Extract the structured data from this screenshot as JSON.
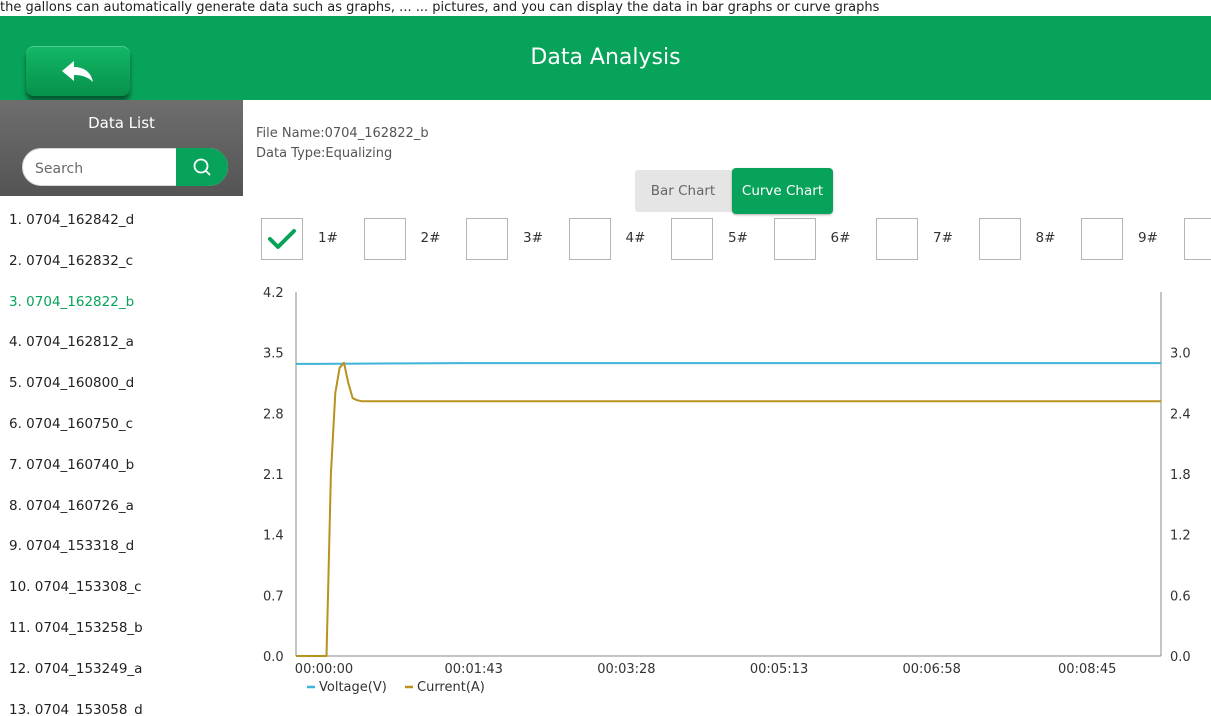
{
  "top_strip_text": "the gallons can automatically generate data such as graphs, ... ... pictures, and you can display the data in bar graphs or curve graphs",
  "header": {
    "title": "Data Analysis",
    "back_icon": "back-arrow-icon"
  },
  "sidebar": {
    "title": "Data List",
    "search": {
      "placeholder": "Search",
      "value": ""
    },
    "items": [
      "1. 0704_162842_d",
      "2. 0704_162832_c",
      "3. 0704_162822_b",
      "4. 0704_162812_a",
      "5. 0704_160800_d",
      "6. 0704_160750_c",
      "7. 0704_160740_b",
      "8. 0704_160726_a",
      "9. 0704_153318_d",
      "10. 0704_153308_c",
      "11. 0704_153258_b",
      "12. 0704_153249_a",
      "13. 0704_153058_d"
    ],
    "selected_index": 2
  },
  "file_info": {
    "file_name": "File Name:0704_162822_b",
    "data_type": "Data Type:Equalizing"
  },
  "view_toggle": {
    "bar_label": "Bar Chart",
    "curve_label": "Curve Chart",
    "active": "Curve Chart"
  },
  "channels": [
    {
      "label": "1#",
      "checked": true
    },
    {
      "label": "2#",
      "checked": false
    },
    {
      "label": "3#",
      "checked": false
    },
    {
      "label": "4#",
      "checked": false
    },
    {
      "label": "5#",
      "checked": false
    },
    {
      "label": "6#",
      "checked": false
    },
    {
      "label": "7#",
      "checked": false
    },
    {
      "label": "8#",
      "checked": false
    },
    {
      "label": "9#",
      "checked": false
    },
    {
      "label": "",
      "checked": false
    }
  ],
  "colors": {
    "primary_green": "#08a35a",
    "voltage": "#3fb4d9",
    "current": "#b8921e",
    "selected_item": "#08a35a"
  },
  "chart_data": {
    "type": "line",
    "x_unit": "seconds",
    "x_ticks": [
      "00:00:00",
      "00:01:43",
      "00:03:28",
      "00:05:13",
      "00:06:58",
      "00:08:45"
    ],
    "x_tick_values": [
      0,
      103,
      208,
      313,
      418,
      525
    ],
    "xlim": [
      -15,
      580
    ],
    "left_axis": {
      "ylim": [
        0,
        4.2
      ],
      "ticks": [
        "0.0",
        "0.7",
        "1.4",
        "2.1",
        "2.8",
        "3.5",
        "4.2"
      ],
      "tick_values": [
        0,
        0.7,
        1.4,
        2.1,
        2.8,
        3.5,
        4.2
      ]
    },
    "right_axis": {
      "ylim": [
        0,
        3.6
      ],
      "ticks": [
        "0.0",
        "0.6",
        "1.2",
        "1.8",
        "2.4",
        "3.0"
      ],
      "tick_values": [
        0,
        0.6,
        1.2,
        1.8,
        2.4,
        3.0
      ]
    },
    "series": [
      {
        "name": "Voltage(V)",
        "axis": "left",
        "color": "#3fb4d9",
        "x": [
          -15,
          0,
          100,
          580
        ],
        "y": [
          3.37,
          3.37,
          3.38,
          3.38
        ]
      },
      {
        "name": "Current(A)",
        "axis": "right",
        "color": "#b8921e",
        "x": [
          -15,
          6,
          7,
          9,
          12,
          15,
          18,
          21,
          24,
          27,
          30,
          580
        ],
        "y": [
          0,
          0,
          0.6,
          1.8,
          2.6,
          2.85,
          2.9,
          2.7,
          2.55,
          2.53,
          2.52,
          2.52
        ]
      }
    ],
    "legend_position": "bottom-left",
    "grid": false
  }
}
